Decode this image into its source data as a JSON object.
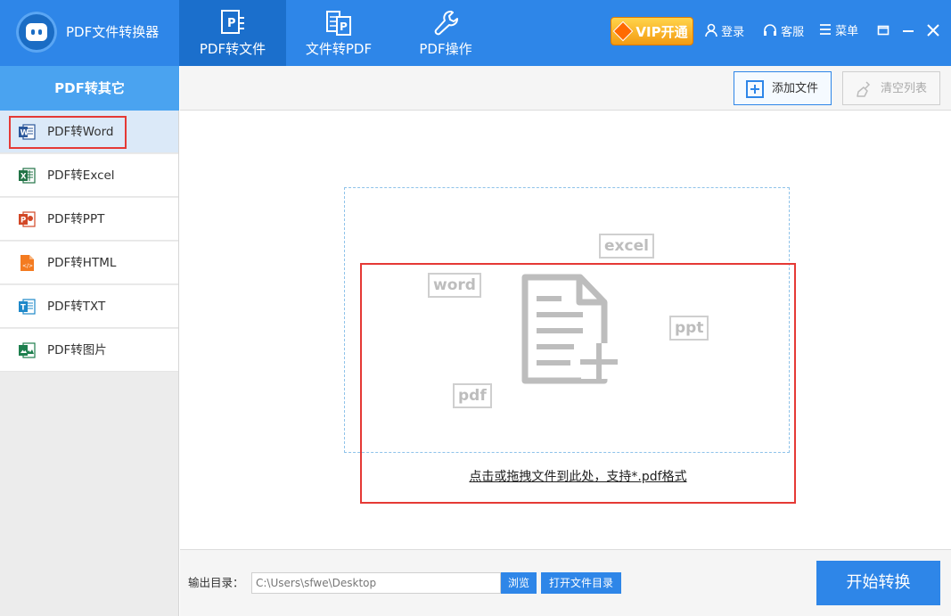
{
  "app": {
    "title": "PDF文件转换器"
  },
  "nav": {
    "tabs": [
      {
        "label": "PDF转文件"
      },
      {
        "label": "文件转PDF"
      },
      {
        "label": "PDF操作"
      }
    ]
  },
  "topbar": {
    "vip": "VIP开通",
    "login": "登录",
    "service": "客服",
    "menu": "菜单"
  },
  "sidebar": {
    "heading": "PDF转其它",
    "items": [
      {
        "label": "PDF转Word"
      },
      {
        "label": "PDF转Excel"
      },
      {
        "label": "PDF转PPT"
      },
      {
        "label": "PDF转HTML"
      },
      {
        "label": "PDF转TXT"
      },
      {
        "label": "PDF转图片"
      }
    ]
  },
  "toolbar": {
    "add_files": "添加文件",
    "clear_list": "清空列表"
  },
  "dropzone": {
    "tags": [
      "word",
      "excel",
      "ppt",
      "pdf"
    ],
    "hint": "点击或拖拽文件到此处，支持*.pdf格式"
  },
  "output": {
    "label": "输出目录：",
    "path": "C:\\Users\\sfwe\\Desktop",
    "browse": "浏览",
    "open_dir": "打开文件目录"
  },
  "actions": {
    "start": "开始转换"
  },
  "colors": {
    "accent": "#2e86e8",
    "highlight": "#e53935"
  }
}
